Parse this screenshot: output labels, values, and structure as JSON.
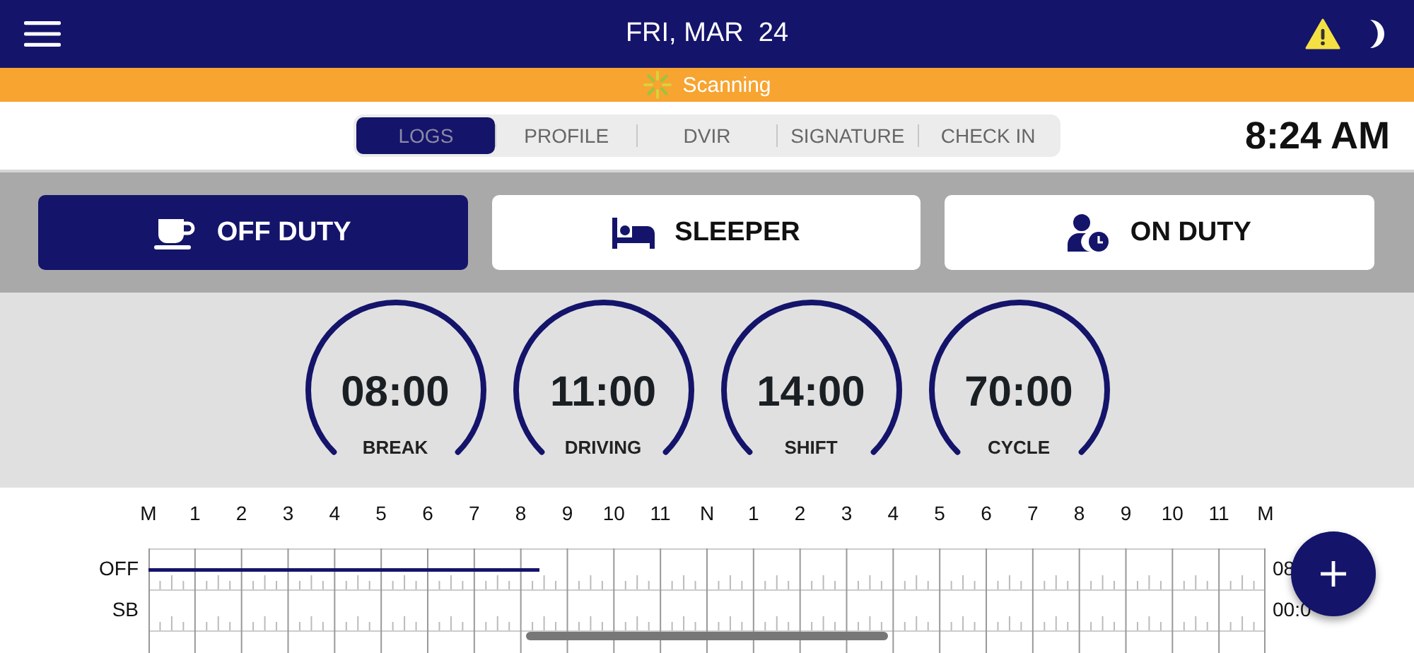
{
  "header": {
    "date": "FRI, MAR  24"
  },
  "status_banner": {
    "text": "Scanning"
  },
  "tabs": [
    {
      "label": "LOGS",
      "selected": true
    },
    {
      "label": "PROFILE",
      "selected": false
    },
    {
      "label": "DVIR",
      "selected": false
    },
    {
      "label": "SIGNATURE",
      "selected": false
    },
    {
      "label": "CHECK IN",
      "selected": false
    }
  ],
  "clock": "8:24 AM",
  "duty_buttons": [
    {
      "label": "OFF DUTY",
      "kind": "off",
      "selected": true
    },
    {
      "label": "SLEEPER",
      "kind": "sleeper",
      "selected": false
    },
    {
      "label": "ON DUTY",
      "kind": "on",
      "selected": false
    }
  ],
  "gauges": [
    {
      "value": "08:00",
      "label": "BREAK",
      "level": 1
    },
    {
      "value": "11:00",
      "label": "DRIVING",
      "level": 1
    },
    {
      "value": "14:00",
      "label": "SHIFT",
      "level": 1
    },
    {
      "value": "70:00",
      "label": "CYCLE",
      "level": 1
    }
  ],
  "log": {
    "hours": [
      "M",
      "1",
      "2",
      "3",
      "4",
      "5",
      "6",
      "7",
      "8",
      "9",
      "10",
      "11",
      "N",
      "1",
      "2",
      "3",
      "4",
      "5",
      "6",
      "7",
      "8",
      "9",
      "10",
      "11",
      "M"
    ],
    "rows": [
      {
        "label": "OFF",
        "total": "08",
        "level": 0.35
      },
      {
        "label": "SB",
        "total": "00:0"
      }
    ]
  }
}
